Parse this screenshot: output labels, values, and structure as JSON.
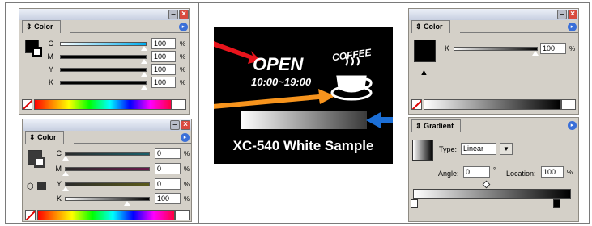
{
  "palette_color_cmyk": {
    "tab_label": "Color",
    "channels": [
      {
        "label": "C",
        "value": "100",
        "unit": "%",
        "level": 1.0
      },
      {
        "label": "M",
        "value": "100",
        "unit": "%",
        "level": 1.0
      },
      {
        "label": "Y",
        "value": "100",
        "unit": "%",
        "level": 1.0
      },
      {
        "label": "K",
        "value": "100",
        "unit": "%",
        "level": 1.0
      }
    ]
  },
  "palette_color_cmyk_2": {
    "tab_label": "Color",
    "channels": [
      {
        "label": "C",
        "value": "0",
        "unit": "%",
        "level": 0.0
      },
      {
        "label": "M",
        "value": "0",
        "unit": "%",
        "level": 0.0
      },
      {
        "label": "Y",
        "value": "0",
        "unit": "%",
        "level": 0.0
      },
      {
        "label": "K",
        "value": "100",
        "unit": "%",
        "level": 1.0
      }
    ]
  },
  "sample_image": {
    "open_text": "OPEN",
    "hours_text": "10:00~19:00",
    "coffee_text": "COFFEE",
    "caption": "XC-540 White Sample",
    "arrow_colors": [
      "#e8141c",
      "#f7941d",
      "#1c6fd6"
    ]
  },
  "palette_color_gray": {
    "tab_label": "Color",
    "channel": {
      "label": "K",
      "value": "100",
      "unit": "%",
      "level": 1.0
    }
  },
  "palette_gradient": {
    "tab_label": "Gradient",
    "type_label": "Type:",
    "type_value": "Linear",
    "angle_label": "Angle:",
    "angle_value": "0",
    "angle_unit": "°",
    "location_label": "Location:",
    "location_value": "100",
    "location_unit": "%"
  },
  "icons": {
    "minimize": "minimize-icon",
    "close": "close-icon",
    "menu": "palette-menu-icon",
    "none_swatch": "none-swatch-icon",
    "print_warning": "out-of-gamut-icon"
  }
}
